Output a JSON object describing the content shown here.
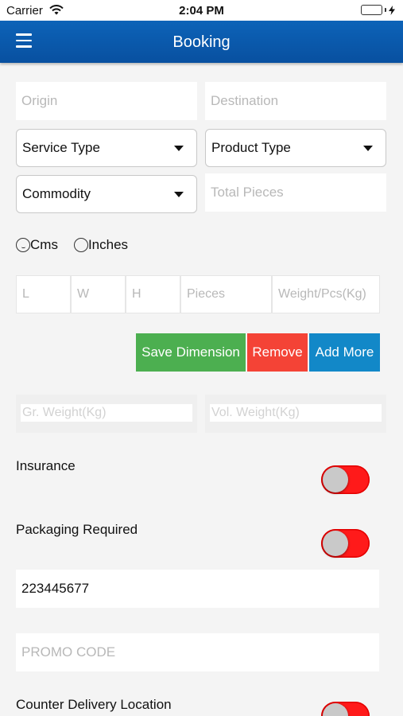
{
  "status_bar": {
    "carrier": "Carrier",
    "time": "2:04 PM"
  },
  "nav": {
    "title": "Booking"
  },
  "form": {
    "origin_placeholder": "Origin",
    "destination_placeholder": "Destination",
    "service_type": "Service Type",
    "product_type": "Product Type",
    "commodity": "Commodity",
    "total_pieces_placeholder": "Total Pieces",
    "unit_options": [
      "Cms",
      "Inches"
    ],
    "dimensions": {
      "length_placeholder": "L",
      "width_placeholder": "W",
      "height_placeholder": "H",
      "pieces_placeholder": "Pieces",
      "weight_placeholder": "Weight/Pcs(Kg)"
    },
    "buttons": {
      "save": "Save Dimension",
      "remove": "Remove",
      "add_more": "Add More"
    },
    "gross_weight_placeholder": "Gr. Weight(Kg)",
    "vol_weight_placeholder": "Vol. Weight(Kg)",
    "insurance_label": "Insurance",
    "packaging_label": "Packaging Required",
    "phone_value": "223445677",
    "promo_placeholder": "PROMO CODE",
    "counter_delivery_label": "Counter Delivery Location"
  },
  "colors": {
    "nav": "#0a5aac",
    "save_button": "#4caf50",
    "remove_button": "#f44336",
    "add_more_button": "#1288c8",
    "toggle_on": "#ff1a1a"
  }
}
